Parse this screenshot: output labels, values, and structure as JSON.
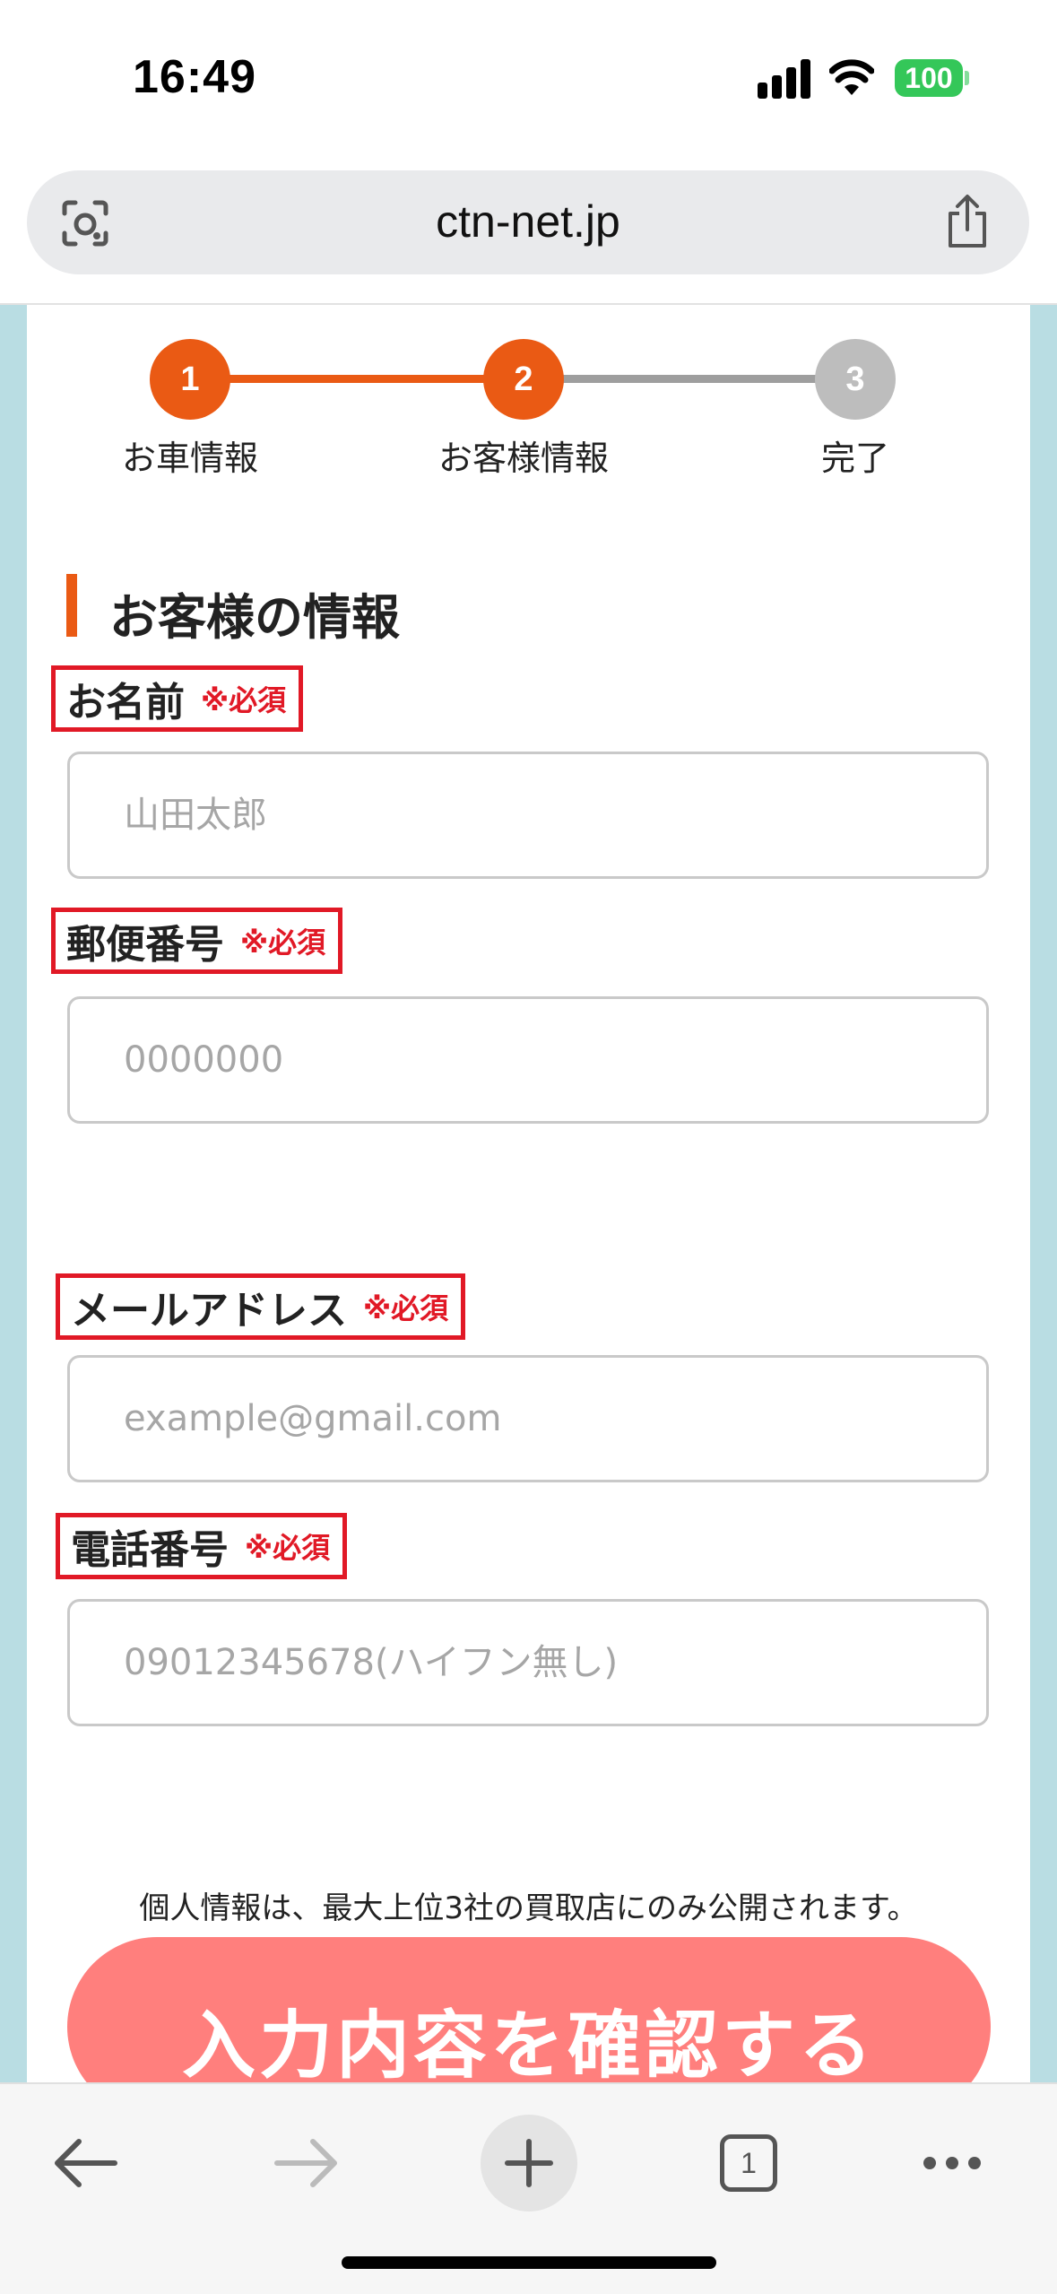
{
  "status_bar": {
    "time": "16:49",
    "battery": "100"
  },
  "browser": {
    "url": "ctn-net.jp",
    "tab_count": "1"
  },
  "steps": [
    {
      "number": "1",
      "label": "お車情報",
      "state": "done",
      "color": "#ea5a14"
    },
    {
      "number": "2",
      "label": "お客様情報",
      "state": "current",
      "color": "#ea5a14"
    },
    {
      "number": "3",
      "label": "完了",
      "state": "pending",
      "color": "#bdbdbd"
    }
  ],
  "section": {
    "title": "お客様の情報"
  },
  "form": {
    "name": {
      "label": "お名前",
      "required": "※必須",
      "placeholder": "山田太郎",
      "value": ""
    },
    "postal": {
      "label": "郵便番号",
      "required": "※必須",
      "placeholder": "0000000",
      "value": ""
    },
    "email": {
      "label": "メールアドレス",
      "required": "※必須",
      "placeholder": "example@gmail.com",
      "value": ""
    },
    "phone": {
      "label": "電話番号",
      "required": "※必須",
      "placeholder": "09012345678(ハイフン無し)",
      "value": ""
    }
  },
  "privacy_note": "個人情報は、最大上位3社の買取店にのみ公開されます。",
  "submit_label": "入力内容を確認する",
  "colors": {
    "accent": "#ea5a14",
    "required": "#e11926",
    "submit": "#ff7f7d",
    "page_bg": "#b9dde3"
  }
}
